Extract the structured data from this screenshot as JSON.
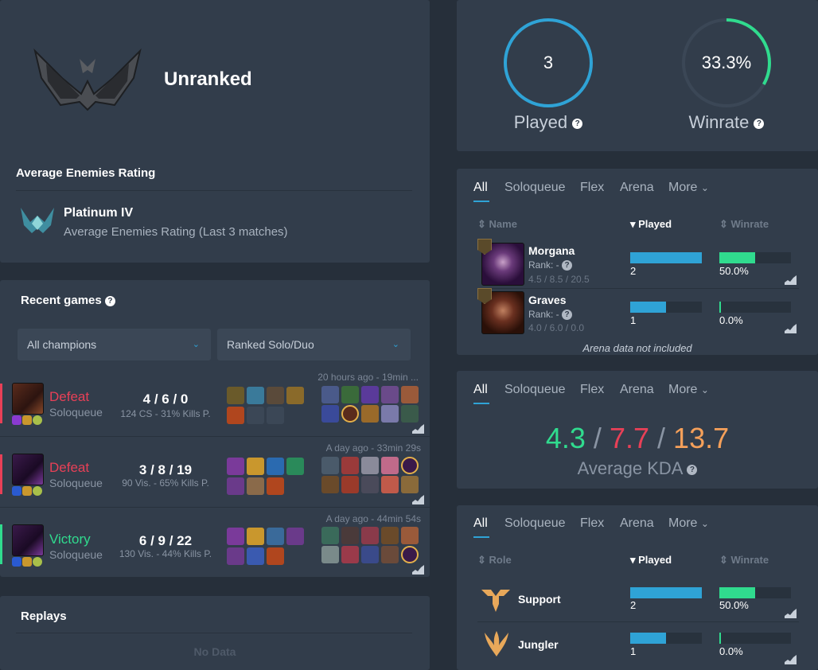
{
  "rank": {
    "tier": "Unranked"
  },
  "avg_enemies": {
    "title": "Average Enemies Rating",
    "tier": "Platinum IV",
    "desc": "Average Enemies Rating (Last 3 matches)"
  },
  "recent_games": {
    "title": "Recent games",
    "filter_champion": "All champions",
    "filter_queue": "Ranked Solo/Duo",
    "games": [
      {
        "result": "Defeat",
        "queue": "Soloqueue",
        "kda": "4 / 6 / 0",
        "stats": "124 CS - 31% Kills P.",
        "time": "20 hours ago - 19min ..."
      },
      {
        "result": "Defeat",
        "queue": "Soloqueue",
        "kda": "3 / 8 / 19",
        "stats": "90 Vis. - 65% Kills P.",
        "time": "A day ago - 33min 29s"
      },
      {
        "result": "Victory",
        "queue": "Soloqueue",
        "kda": "6 / 9 / 22",
        "stats": "130 Vis. - 44% Kills P.",
        "time": "A day ago - 44min 54s"
      }
    ]
  },
  "replays": {
    "title": "Replays",
    "empty": "No Data"
  },
  "summary": {
    "played_value": "3",
    "played_label": "Played",
    "winrate_value": "33.3%",
    "winrate_label": "Winrate",
    "winrate_fraction": 0.333
  },
  "tabs": {
    "all": "All",
    "solo": "Soloqueue",
    "flex": "Flex",
    "arena": "Arena",
    "more": "More"
  },
  "champions": {
    "headers": {
      "name": "Name",
      "played": "Played",
      "winrate": "Winrate"
    },
    "rows": [
      {
        "name": "Morgana",
        "rank_label": "Rank: -",
        "kda": "4.5 / 8.5 / 20.5",
        "played": "2",
        "played_fraction": 1.0,
        "winrate": "50.0%",
        "winrate_fraction": 0.5
      },
      {
        "name": "Graves",
        "rank_label": "Rank: -",
        "kda": "4.0 / 6.0 / 0.0",
        "played": "1",
        "played_fraction": 0.5,
        "winrate": "0.0%",
        "winrate_fraction": 0.0
      }
    ],
    "note": "Arena data not included"
  },
  "kda": {
    "kills": "4.3",
    "deaths": "7.7",
    "assists": "13.7",
    "separator": "/",
    "label": "Average KDA"
  },
  "roles": {
    "headers": {
      "role": "Role",
      "played": "Played",
      "winrate": "Winrate"
    },
    "rows": [
      {
        "name": "Support",
        "played": "2",
        "played_fraction": 1.0,
        "winrate": "50.0%",
        "winrate_fraction": 0.5
      },
      {
        "name": "Jungler",
        "played": "1",
        "played_fraction": 0.5,
        "winrate": "0.0%",
        "winrate_fraction": 0.0
      }
    ]
  },
  "colors": {
    "accent": "#2fa3d6",
    "win": "#30db8e",
    "loss": "#e84057",
    "assist": "#f5a05a"
  }
}
